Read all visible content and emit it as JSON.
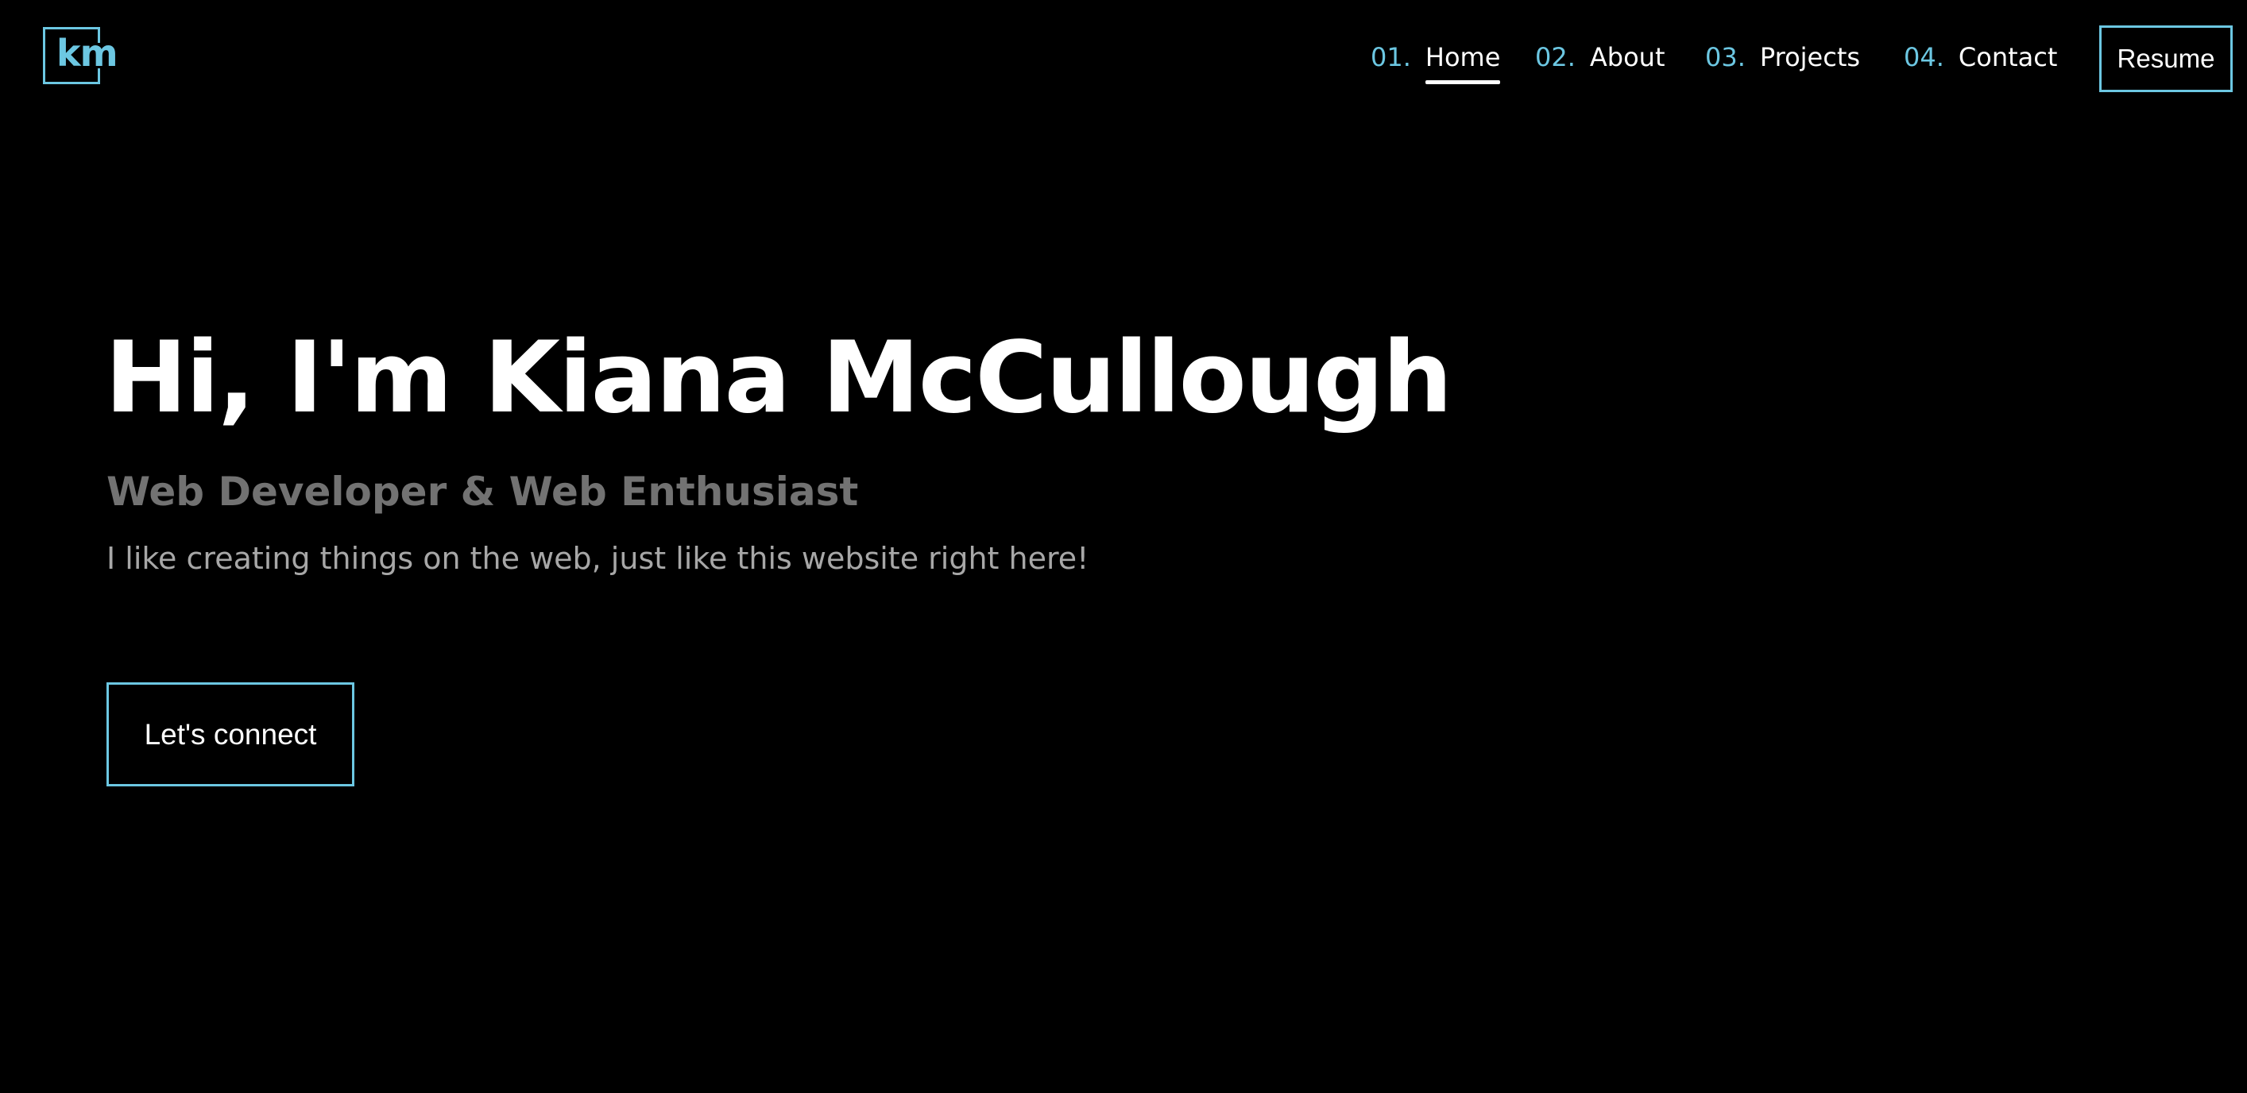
{
  "brand": {
    "logo_text": "km",
    "accent_color": "#6cc7e2"
  },
  "nav": {
    "items": [
      {
        "number": "01.",
        "label": "Home",
        "active": true
      },
      {
        "number": "02.",
        "label": "About",
        "active": false
      },
      {
        "number": "03.",
        "label": "Projects",
        "active": false
      },
      {
        "number": "04.",
        "label": "Contact",
        "active": false
      }
    ],
    "resume_label": "Resume"
  },
  "hero": {
    "title": "Hi, I'm Kiana McCullough",
    "subtitle": "Web Developer & Web Enthusiast",
    "description": "I like creating things on the web, just like this website right here!",
    "cta_label": "Let's connect"
  },
  "colors": {
    "background": "#000000",
    "text_primary": "#ffffff",
    "subtitle": "#727272",
    "description": "#a7a7a7"
  }
}
